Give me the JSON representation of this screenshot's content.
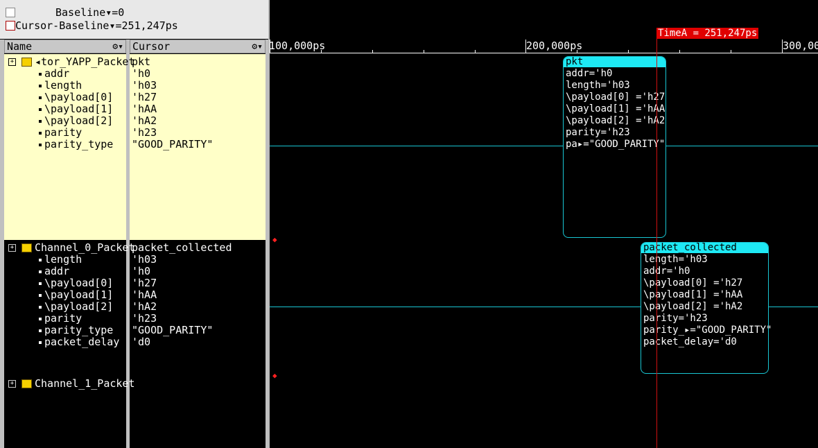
{
  "info": {
    "baseline": "Baseline▾=0",
    "cursor_baseline": "Cursor-Baseline▾=251,247ps"
  },
  "columns": {
    "name": "Name",
    "cursor": "Cursor"
  },
  "ruler": {
    "labels": [
      "100,000ps",
      "200,000ps",
      "300,00"
    ],
    "cursor_label": "TimeA = 251,247ps"
  },
  "groups": [
    {
      "name": "◂tor_YAPP_Packet",
      "value": "pkt",
      "fields": [
        {
          "name": "addr",
          "value": "'h0"
        },
        {
          "name": "length",
          "value": "'h03"
        },
        {
          "name": "\\payload[0]",
          "value": "'h27"
        },
        {
          "name": "\\payload[1]",
          "value": "'hAA"
        },
        {
          "name": "\\payload[2]",
          "value": "'hA2"
        },
        {
          "name": "parity",
          "value": "'h23"
        },
        {
          "name": "parity_type",
          "value": "\"GOOD_PARITY\""
        }
      ]
    },
    {
      "name": "Channel_0_Packet",
      "value": "packet_collected",
      "fields": [
        {
          "name": "length",
          "value": "'h03"
        },
        {
          "name": "addr",
          "value": "'h0"
        },
        {
          "name": "\\payload[0]",
          "value": "'h27"
        },
        {
          "name": "\\payload[1]",
          "value": "'hAA"
        },
        {
          "name": "\\payload[2]",
          "value": "'hA2"
        },
        {
          "name": "parity",
          "value": "'h23"
        },
        {
          "name": "parity_type",
          "value": "\"GOOD_PARITY\""
        },
        {
          "name": "packet_delay",
          "value": "'d0"
        }
      ]
    },
    {
      "name": "Channel_1_Packet",
      "value": "",
      "fields": []
    }
  ],
  "transactions": [
    {
      "title": "pkt",
      "lines": [
        "addr='h0",
        "length='h03",
        "\\payload[0] ='h27",
        "\\payload[1] ='hAA",
        "\\payload[2] ='hA2",
        "parity='h23",
        "pa▸=\"GOOD_PARITY\""
      ]
    },
    {
      "title": "packet_collected",
      "lines": [
        "length='h03",
        "addr='h0",
        "\\payload[0] ='h27",
        "\\payload[1] ='hAA",
        "\\payload[2] ='hA2",
        "parity='h23",
        "parity_▸=\"GOOD_PARITY\"",
        "packet_delay='d0"
      ]
    }
  ]
}
